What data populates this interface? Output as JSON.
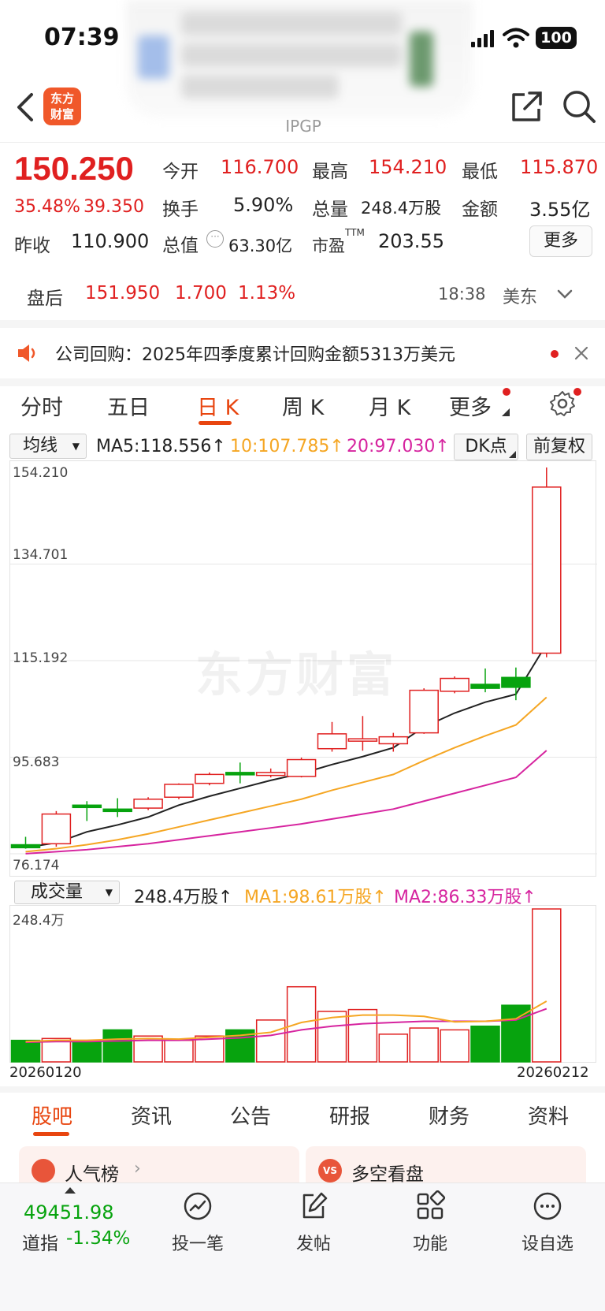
{
  "status_bar": {
    "time": "07:39",
    "battery": "100"
  },
  "header": {
    "logo_text_1": "东方",
    "logo_text_2": "财富",
    "ticker": "IPGP"
  },
  "quote": {
    "price": "150.250",
    "change_pct": "35.48%",
    "change": "39.350",
    "open_label": "今开",
    "open": "116.700",
    "high_label": "最高",
    "high": "154.210",
    "low_label": "最低",
    "low": "115.870",
    "turnover_label": "换手",
    "turnover": "5.90%",
    "volume_label": "总量",
    "volume": "248.4万股",
    "amount_label": "金额",
    "amount": "3.55亿",
    "prev_close_label": "昨收",
    "prev_close": "110.900",
    "mktcap_label": "总值",
    "mktcap": "63.30亿",
    "pe_label": "市盈",
    "pe_sup": "TTM",
    "pe": "203.55",
    "more_button": "更多"
  },
  "after_hours": {
    "label": "盘后",
    "price": "151.950",
    "change": "1.700",
    "change_pct": "1.13%",
    "time": "18:38",
    "market": "美东"
  },
  "news": {
    "text": "公司回购：2025年四季度累计回购金额5313万美元"
  },
  "chart_tabs": [
    "分时",
    "五日",
    "日 K",
    "周 K",
    "月 K",
    "更多"
  ],
  "ma_bar": {
    "select": "均线",
    "ma5": "MA5:118.556↑",
    "ma10": "10:107.785↑",
    "ma20": "20:97.030↑",
    "dk": "DK点",
    "adjust": "前复权"
  },
  "volume_bar": {
    "select": "成交量",
    "vol": "248.4万股↑",
    "ma1": "MA1:98.61万股↑",
    "ma2": "MA2:86.33万股↑"
  },
  "colors": {
    "up": "#e02020",
    "down": "#07a30e",
    "ma5": "#222222",
    "ma10": "#f5a623",
    "ma20": "#d6249f",
    "accent": "#e8450f"
  },
  "chart_data": {
    "type": "candlestick",
    "y_labels": [
      "154.210",
      "134.701",
      "115.192",
      "95.683",
      "76.174"
    ],
    "ylim": [
      76.174,
      154.21
    ],
    "dates_shown": [
      "20260120",
      "20260212"
    ],
    "watermark": "东方财富",
    "candles": [
      {
        "o": 78.0,
        "h": 79.6,
        "l": 77.2,
        "c": 77.4
      },
      {
        "o": 78.2,
        "h": 84.8,
        "l": 77.6,
        "c": 84.2
      },
      {
        "o": 86.0,
        "h": 86.8,
        "l": 82.8,
        "c": 85.6
      },
      {
        "o": 85.2,
        "h": 87.4,
        "l": 83.6,
        "c": 84.8
      },
      {
        "o": 85.4,
        "h": 87.6,
        "l": 85.0,
        "c": 87.2
      },
      {
        "o": 87.6,
        "h": 90.4,
        "l": 87.2,
        "c": 90.2
      },
      {
        "o": 90.4,
        "h": 92.6,
        "l": 90.0,
        "c": 92.2
      },
      {
        "o": 92.6,
        "h": 94.6,
        "l": 90.4,
        "c": 92.4
      },
      {
        "o": 92.0,
        "h": 93.4,
        "l": 91.6,
        "c": 92.6
      },
      {
        "o": 91.8,
        "h": 95.6,
        "l": 91.6,
        "c": 95.2
      },
      {
        "o": 97.4,
        "h": 102.8,
        "l": 96.8,
        "c": 100.4
      },
      {
        "o": 99.0,
        "h": 104.0,
        "l": 97.0,
        "c": 99.4
      },
      {
        "o": 98.4,
        "h": 100.6,
        "l": 96.8,
        "c": 99.8
      },
      {
        "o": 100.6,
        "h": 109.6,
        "l": 100.4,
        "c": 109.2
      },
      {
        "o": 109.0,
        "h": 112.0,
        "l": 108.6,
        "c": 111.6
      },
      {
        "o": 110.4,
        "h": 113.6,
        "l": 108.8,
        "c": 109.6
      },
      {
        "o": 111.8,
        "h": 113.8,
        "l": 107.2,
        "c": 109.8
      },
      {
        "o": 116.7,
        "h": 154.21,
        "l": 115.87,
        "c": 150.25
      }
    ],
    "ma5": [
      77.4,
      78.4,
      80.6,
      82.0,
      83.6,
      86.0,
      87.8,
      89.4,
      91.0,
      92.4,
      94.2,
      95.8,
      97.6,
      101.8,
      104.6,
      106.8,
      108.4,
      118.556
    ],
    "ma10": [
      76.6,
      77.2,
      78.0,
      79.0,
      80.2,
      81.6,
      83.0,
      84.4,
      85.8,
      87.2,
      89.0,
      90.6,
      92.2,
      95.0,
      97.6,
      100.0,
      102.2,
      107.785
    ],
    "ma20": [
      76.2,
      76.6,
      77.0,
      77.6,
      78.2,
      79.0,
      79.8,
      80.6,
      81.4,
      82.2,
      83.2,
      84.2,
      85.2,
      86.8,
      88.4,
      90.0,
      91.6,
      97.03
    ],
    "volume": {
      "max_label": "248.4万",
      "ylim": [
        0,
        248.4
      ],
      "values": [
        35,
        38,
        32,
        52,
        42,
        35,
        42,
        52,
        68,
        122,
        82,
        85,
        45,
        55,
        52,
        58,
        92,
        248.4
      ],
      "ma1": [
        33,
        35,
        35,
        37,
        38,
        37,
        40,
        43,
        48,
        64,
        72,
        76,
        76,
        74,
        65,
        66,
        70,
        98.61
      ],
      "ma2": [
        32,
        33,
        33,
        34,
        35,
        35,
        37,
        39,
        43,
        52,
        58,
        62,
        64,
        66,
        66,
        66,
        68,
        86.33
      ]
    }
  },
  "bottom_tabs": [
    "股吧",
    "资讯",
    "公告",
    "研报",
    "财务",
    "资料"
  ],
  "cards": {
    "left": "人气榜",
    "right": "多空看盘"
  },
  "bottom_nav": {
    "index_value": "49451.98",
    "index_name": "道指",
    "index_change": "-1.34%",
    "items": [
      "投一笔",
      "发帖",
      "功能",
      "设自选"
    ]
  }
}
